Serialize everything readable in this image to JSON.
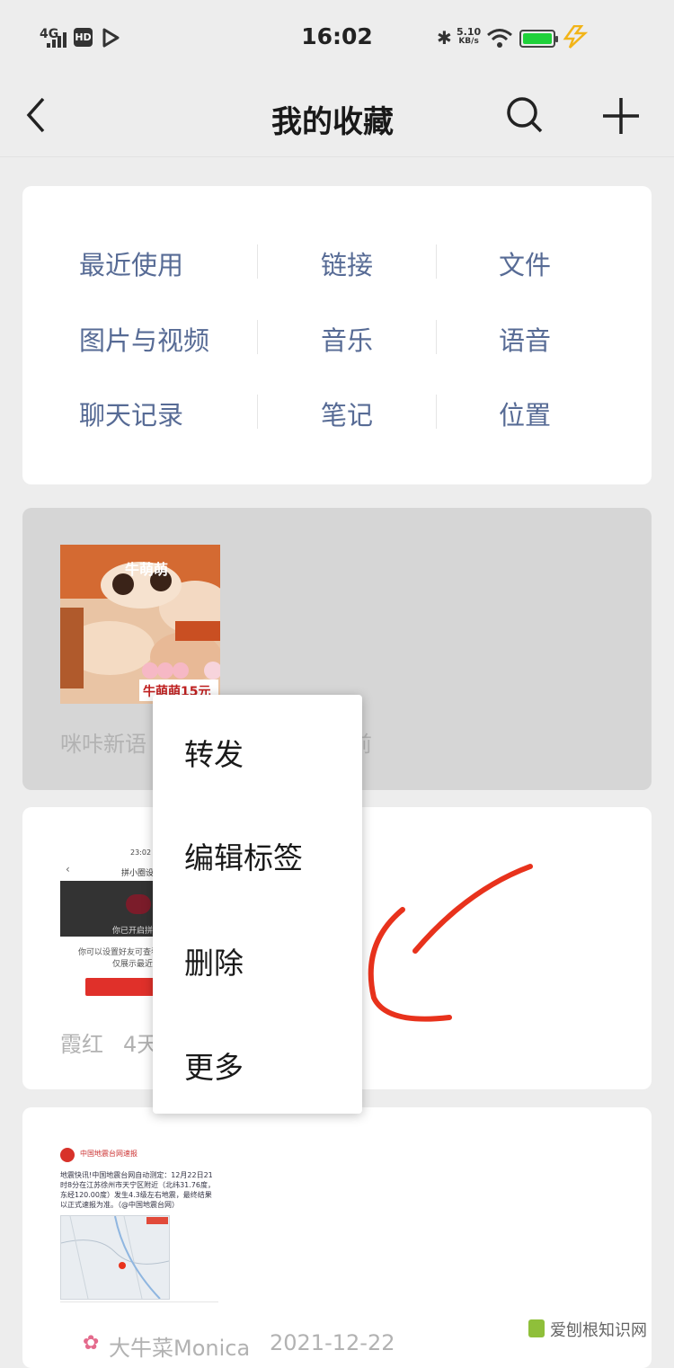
{
  "status_bar": {
    "network": "4G",
    "hd_badge": "HD",
    "time": "16:02",
    "speed_value": "5.10",
    "speed_unit": "KB/s"
  },
  "nav": {
    "title": "我的收藏"
  },
  "categories": {
    "row1": [
      "最近使用",
      "链接",
      "文件"
    ],
    "row2": [
      "图片与视频",
      "音乐",
      "语音"
    ],
    "row3": [
      "聊天记录",
      "笔记",
      "位置"
    ]
  },
  "favorites": [
    {
      "thumb_brand": "牛萌萌",
      "thumb_price_tag": "牛萌萌15元",
      "source_visible": "咪咔新语",
      "time_visible": "前"
    },
    {
      "source": "霞红",
      "time_visible": "4天",
      "thumb_time": "23:02",
      "thumb_title": "拼小圈设置",
      "thumb_text1": "你已开启拼",
      "thumb_text2": "你可以设置好友可查看",
      "thumb_text3": "仅展示最近"
    },
    {
      "source": "大牛菜Monica",
      "date": "2021-12-22",
      "thumb_header": "中国地震台网速报",
      "thumb_body": "地震快讯!中国地震台网自动测定：12月22日21时8分在江苏徐州市天宁区附近（北纬31.76度，东经120.00度）发生4.3级左右地震，最终结果以正式速报为准。（@中国地震台网）"
    }
  ],
  "context_menu": {
    "items": [
      "转发",
      "编辑标签",
      "删除",
      "更多"
    ]
  },
  "watermark": {
    "text": "爱刨根知识网"
  },
  "annotation": {
    "arrow_color": "#e8321c"
  }
}
